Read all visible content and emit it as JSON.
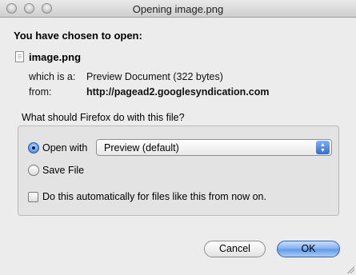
{
  "window": {
    "title": "Opening image.png"
  },
  "dialog": {
    "heading": "You have chosen to open:",
    "file_name": "image.png",
    "which_is_label": "which is a:",
    "which_is_value": "Preview Document (322 bytes)",
    "from_label": "from:",
    "from_value": "http://pagead2.googlesyndication.com",
    "question": "What should Firefox do with this file?"
  },
  "options": {
    "open_with_label": "Open with",
    "open_with_selected": true,
    "app_select_value": "Preview (default)",
    "save_file_label": "Save File",
    "save_file_selected": false,
    "auto_label": "Do this automatically for files like this from now on.",
    "auto_checked": false
  },
  "buttons": {
    "cancel_label": "Cancel",
    "ok_label": "OK"
  },
  "icons": {
    "file": "document-icon",
    "select_arrows": "up-down-arrows-icon"
  },
  "colors": {
    "accent": "#2f6fd0",
    "window_bg": "#ececec"
  }
}
